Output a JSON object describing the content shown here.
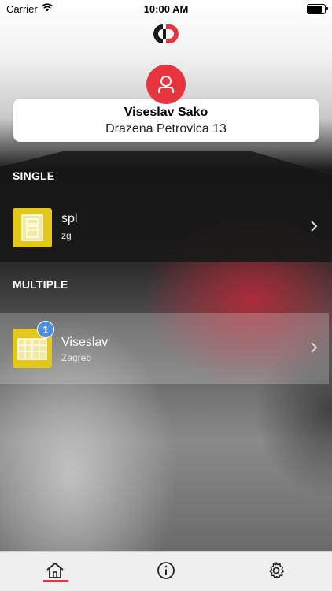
{
  "status_bar": {
    "carrier": "Carrier",
    "time": "10:00 AM"
  },
  "profile": {
    "name": "Viseslav Sako",
    "address": "Drazena Petrovica 13"
  },
  "sections": {
    "single": {
      "title": "SINGLE",
      "items": [
        {
          "title": "spl",
          "subtitle": "zg"
        }
      ]
    },
    "multiple": {
      "title": "MULTIPLE",
      "items": [
        {
          "title": "Viseslav",
          "subtitle": "Zagreb",
          "badge": "1"
        }
      ]
    }
  },
  "tabbar": {
    "tabs": [
      {
        "icon": "home-icon",
        "active": true
      },
      {
        "icon": "info-icon",
        "active": false
      },
      {
        "icon": "gear-icon",
        "active": false
      }
    ]
  },
  "colors": {
    "accent": "#e8343f",
    "tile": "#e3c81a",
    "badge": "#4a90e2"
  }
}
